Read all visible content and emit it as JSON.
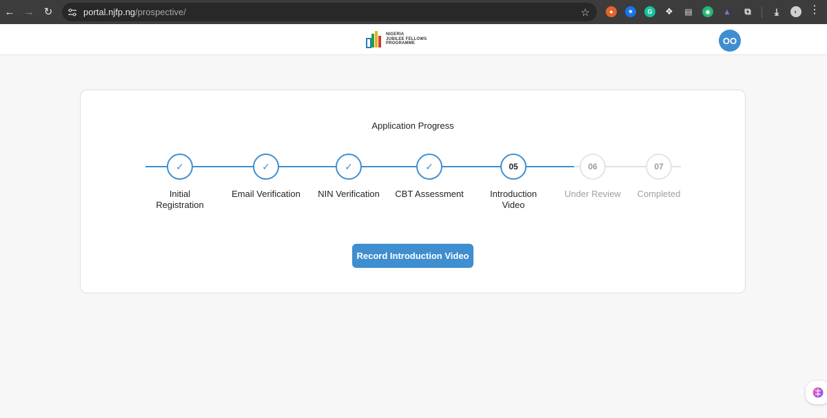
{
  "browser": {
    "url_host": "portal.njfp.ng",
    "url_path": "/prospective/",
    "icons": [
      "back-arrow-icon",
      "forward-arrow-icon",
      "reload-icon",
      "site-settings-icon",
      "bookmark-star-icon",
      "extensions-icon",
      "download-icon",
      "profile-icon",
      "menu-icon"
    ]
  },
  "header": {
    "logo_lines": [
      "NIGERIA",
      "JUBILEE FELLOWS",
      "PROGRAMME"
    ],
    "avatar_initials": "OO"
  },
  "progress": {
    "title": "Application Progress",
    "steps": [
      {
        "label": "Initial Registration",
        "status": "done",
        "number": ""
      },
      {
        "label": "Email Verification",
        "status": "done",
        "number": ""
      },
      {
        "label": "NIN Verification",
        "status": "done",
        "number": ""
      },
      {
        "label": "CBT Assessment",
        "status": "done",
        "number": ""
      },
      {
        "label": "Introduction Video",
        "status": "current",
        "number": "05"
      },
      {
        "label": "Under Review",
        "status": "todo",
        "number": "06"
      },
      {
        "label": "Completed",
        "status": "todo",
        "number": "07"
      }
    ],
    "check_glyph": "✓",
    "cta_label": "Record Introduction Video"
  },
  "colors": {
    "accent": "#3e8ed0",
    "inactive": "#e4e4e4",
    "background": "#f7f7f7"
  }
}
